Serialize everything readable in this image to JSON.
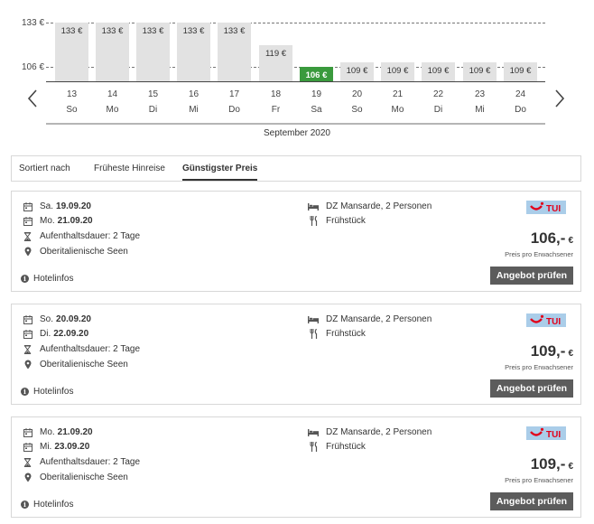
{
  "calendar": {
    "y_ticks": [
      "133 €",
      "106 €"
    ],
    "month_label": "September 2020",
    "days": [
      {
        "num": "13",
        "wd": "So",
        "price": "133 €",
        "selected": false
      },
      {
        "num": "14",
        "wd": "Mo",
        "price": "133 €",
        "selected": false
      },
      {
        "num": "15",
        "wd": "Di",
        "price": "133 €",
        "selected": false
      },
      {
        "num": "16",
        "wd": "Mi",
        "price": "133 €",
        "selected": false
      },
      {
        "num": "17",
        "wd": "Do",
        "price": "133 €",
        "selected": false
      },
      {
        "num": "18",
        "wd": "Fr",
        "price": "119 €",
        "selected": false
      },
      {
        "num": "19",
        "wd": "Sa",
        "price": "106 €",
        "selected": true
      },
      {
        "num": "20",
        "wd": "So",
        "price": "109 €",
        "selected": false
      },
      {
        "num": "21",
        "wd": "Mo",
        "price": "109 €",
        "selected": false
      },
      {
        "num": "22",
        "wd": "Di",
        "price": "109 €",
        "selected": false
      },
      {
        "num": "23",
        "wd": "Mi",
        "price": "109 €",
        "selected": false
      },
      {
        "num": "24",
        "wd": "Do",
        "price": "109 €",
        "selected": false
      }
    ]
  },
  "sort": {
    "label": "Sortiert nach",
    "options": [
      "Früheste Hinreise",
      "Günstigster Preis"
    ],
    "active": 1
  },
  "offers": [
    {
      "dep_day": "Sa.",
      "dep_date": "19.09.20",
      "ret_day": "Mo.",
      "ret_date": "21.09.20",
      "duration": "Aufenthaltsdauer: 2 Tage",
      "region": "Oberitalienische Seen",
      "room": "DZ Mansarde, 2 Personen",
      "board": "Frühstück",
      "operator": "TUI",
      "price": "106,-",
      "currency": "€",
      "price_note": "Preis pro Erwachsener",
      "cta": "Angebot prüfen",
      "info": "Hotelinfos"
    },
    {
      "dep_day": "So.",
      "dep_date": "20.09.20",
      "ret_day": "Di.",
      "ret_date": "22.09.20",
      "duration": "Aufenthaltsdauer: 2 Tage",
      "region": "Oberitalienische Seen",
      "room": "DZ Mansarde, 2 Personen",
      "board": "Frühstück",
      "operator": "TUI",
      "price": "109,-",
      "currency": "€",
      "price_note": "Preis pro Erwachsener",
      "cta": "Angebot prüfen",
      "info": "Hotelinfos"
    },
    {
      "dep_day": "Mo.",
      "dep_date": "21.09.20",
      "ret_day": "Mi.",
      "ret_date": "23.09.20",
      "duration": "Aufenthaltsdauer: 2 Tage",
      "region": "Oberitalienische Seen",
      "room": "DZ Mansarde, 2 Personen",
      "board": "Frühstück",
      "operator": "TUI",
      "price": "109,-",
      "currency": "€",
      "price_note": "Preis pro Erwachsener",
      "cta": "Angebot prüfen",
      "info": "Hotelinfos"
    }
  ],
  "colors": {
    "selected_bar": "#3a9a3d",
    "bar": "#e2e2e2",
    "button": "#5c5c5c",
    "logo_bg": "#aacde9",
    "logo_red": "#e2001a"
  },
  "icons": {
    "calendar": "calendar-icon",
    "duration": "hourglass-icon",
    "location": "map-pin-icon",
    "room": "bed-icon",
    "board": "cutlery-icon",
    "info": "info-icon",
    "prev": "chevron-left-icon",
    "next": "chevron-right-icon"
  }
}
